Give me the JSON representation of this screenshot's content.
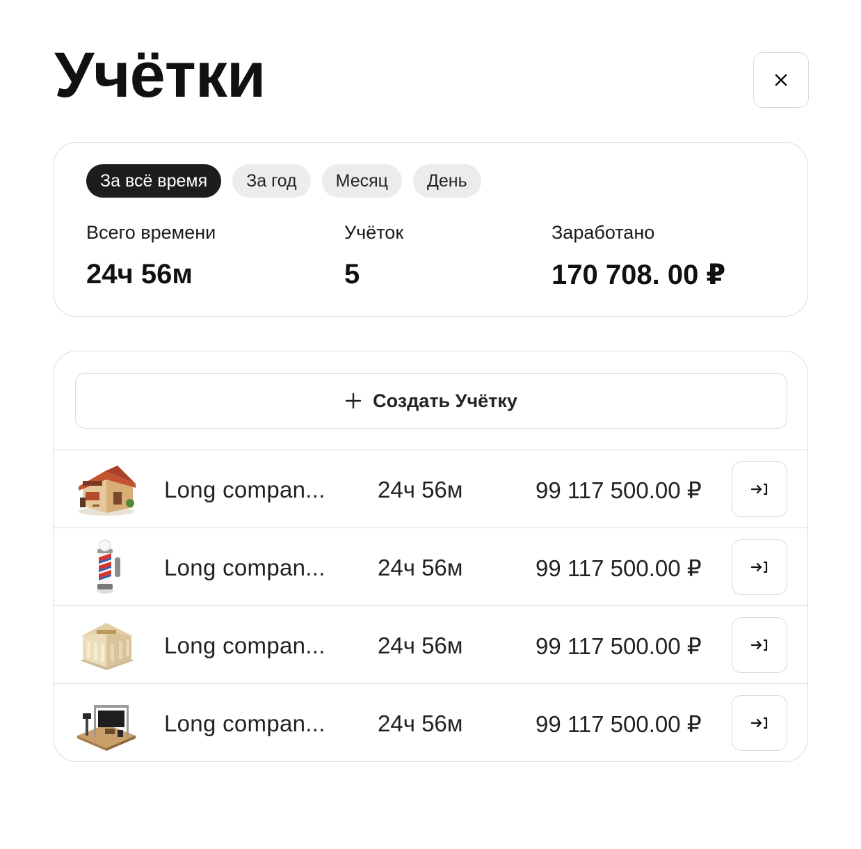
{
  "header": {
    "title": "Учётки",
    "close_icon": "close-icon"
  },
  "filters": [
    {
      "label": "За всё время",
      "active": true
    },
    {
      "label": "За год",
      "active": false
    },
    {
      "label": "Месяц",
      "active": false
    },
    {
      "label": "День",
      "active": false
    }
  ],
  "stats": {
    "total_time": {
      "label": "Всего времени",
      "value": "24ч 56м"
    },
    "accounts": {
      "label": "Учёток",
      "value": "5"
    },
    "earned": {
      "label": "Заработано",
      "value": "170 708. 00 ₽"
    }
  },
  "create_button": {
    "label": "Создать Учётку",
    "icon": "plus-icon"
  },
  "rows": [
    {
      "icon": "restaurant-icon",
      "name": "Long compan...",
      "time": "24ч 56м",
      "amount": "99 117 500.00 ₽",
      "action_icon": "enter-icon"
    },
    {
      "icon": "barber-pole-icon",
      "name": "Long compan...",
      "time": "24ч 56м",
      "amount": "99 117 500.00 ₽",
      "action_icon": "enter-icon"
    },
    {
      "icon": "bank-icon",
      "name": "Long compan...",
      "time": "24ч 56м",
      "amount": "99 117 500.00 ₽",
      "action_icon": "enter-icon"
    },
    {
      "icon": "stage-icon",
      "name": "Long compan...",
      "time": "24ч 56м",
      "amount": "99 117 500.00 ₽",
      "action_icon": "enter-icon"
    }
  ],
  "colors": {
    "active_chip": "#1d1d1d",
    "chip": "#ececec",
    "border": "#dcdcdc",
    "text": "#111111"
  }
}
